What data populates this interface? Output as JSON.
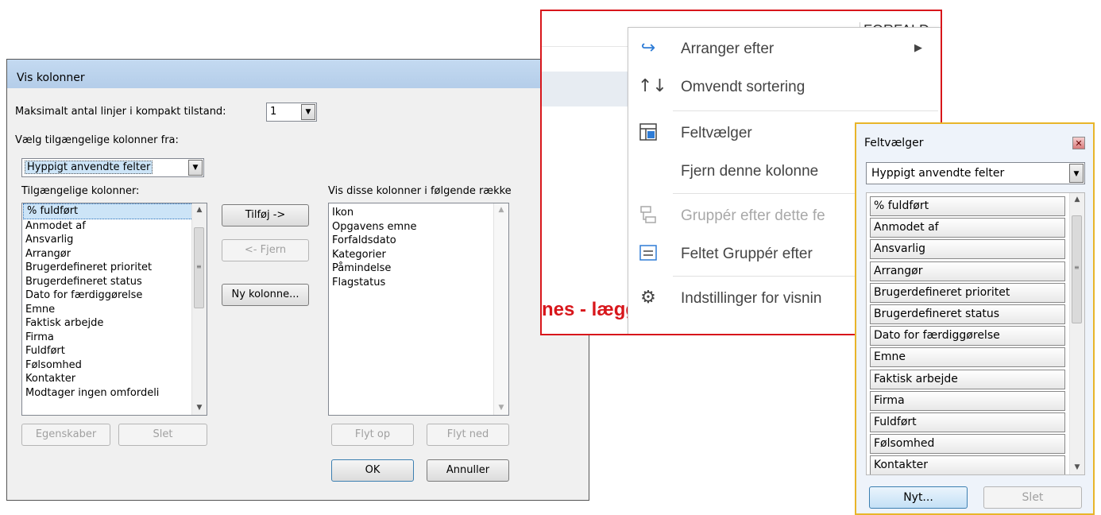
{
  "vis_kolonner": {
    "title": "Vis kolonner",
    "max_lines_label": "Maksimalt antal linjer i kompakt tilstand:",
    "max_lines_value": "1",
    "choose_from_label": "Vælg tilgængelige kolonner fra:",
    "choose_from_value": "Hyppigt anvendte felter",
    "available_label": "Tilgængelige kolonner:",
    "available_items": [
      "% fuldført",
      "Anmodet af",
      "Ansvarlig",
      "Arrangør",
      "Brugerdefineret prioritet",
      "Brugerdefineret status",
      "Dato for færdiggørelse",
      "Emne",
      "Faktisk arbejde",
      "Firma",
      "Fuldført",
      "Følsomhed",
      "Kontakter",
      "Modtager ingen omfordeli"
    ],
    "shown_label": "Vis disse kolonner i følgende række",
    "shown_items": [
      "Ikon",
      "Opgavens emne",
      "Forfaldsdato",
      "Kategorier",
      "Påmindelse",
      "Flagstatus"
    ],
    "add_button": "Tilføj ->",
    "remove_button": "<- Fjern",
    "new_column_button": "Ny kolonne...",
    "properties_button": "Egenskaber",
    "delete_button": "Slet",
    "move_up_button": "Flyt op",
    "move_down_button": "Flyt ned",
    "ok_button": "OK",
    "cancel_button": "Annuller"
  },
  "context_menu": {
    "header_fragment": "FORFALD",
    "background_text": "nes - lægges i tilbud og ...",
    "items": [
      {
        "label": "Arranger efter",
        "icon": "arrange-icon",
        "has_submenu": true,
        "enabled": true
      },
      {
        "label": "Omvendt sortering",
        "icon": "reverse-sort-icon",
        "enabled": true
      },
      {
        "label": "Feltvælger",
        "icon": "field-chooser-icon",
        "enabled": true
      },
      {
        "label": "Fjern denne kolonne",
        "icon": "",
        "enabled": true
      },
      {
        "label": "Gruppér efter dette fe",
        "icon": "group-by-icon",
        "enabled": false
      },
      {
        "label": "Feltet Gruppér efter",
        "icon": "group-by-box-icon",
        "enabled": true
      },
      {
        "label": "Indstillinger for visnin",
        "icon": "gear-icon",
        "enabled": true
      }
    ],
    "accent_color": "#d8161b"
  },
  "feltvaelger": {
    "title": "Feltvælger",
    "dropdown_value": "Hyppigt anvendte felter",
    "fields": [
      "% fuldført",
      "Anmodet af",
      "Ansvarlig",
      "Arrangør",
      "Brugerdefineret prioritet",
      "Brugerdefineret status",
      "Dato for færdiggørelse",
      "Emne",
      "Faktisk arbejde",
      "Firma",
      "Fuldført",
      "Følsomhed",
      "Kontakter"
    ],
    "new_button": "Nyt...",
    "delete_button": "Slet",
    "border_color": "#e8b52a"
  }
}
